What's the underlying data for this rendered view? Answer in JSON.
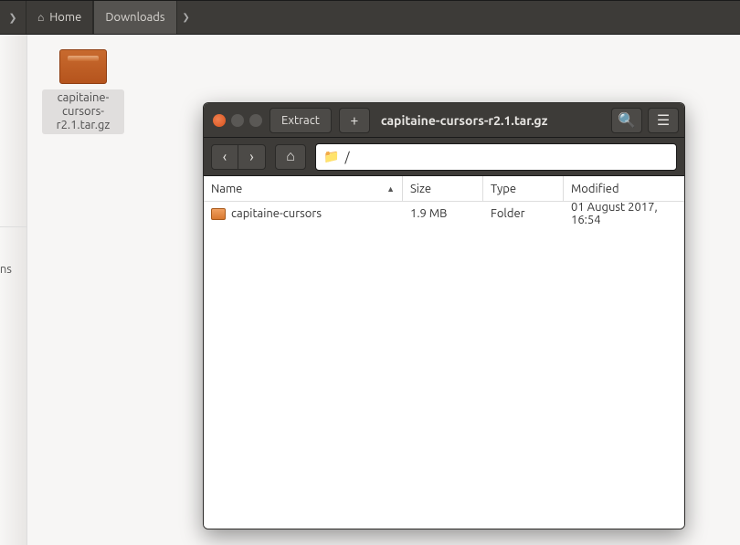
{
  "file_manager": {
    "breadcrumb": {
      "home": "Home",
      "downloads": "Downloads"
    },
    "sidebar_partial_label": "tions",
    "selected_file": "capitaine-cursors-r2.1.tar.gz"
  },
  "archive_manager": {
    "title": "capitaine-cursors-r2.1.tar.gz",
    "extract_label": "Extract",
    "path_value": "/",
    "columns": {
      "name": "Name",
      "size": "Size",
      "type": "Type",
      "modified": "Modified"
    },
    "entries": [
      {
        "name": "capitaine-cursors",
        "size": "1.9 MB",
        "type": "Folder",
        "modified": "01 August 2017, 16:54"
      }
    ]
  }
}
